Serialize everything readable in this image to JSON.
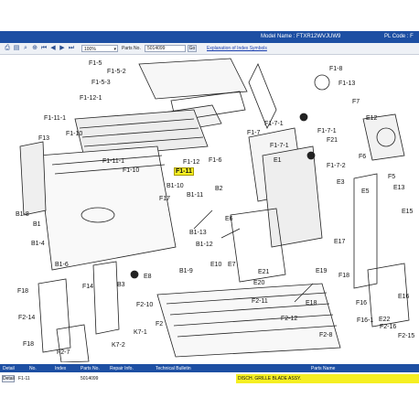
{
  "header": {
    "model": "Model Name : FTXR12WVJUW9",
    "pl_code": "PL Code : F"
  },
  "toolbar": {
    "zoom_value": "100%",
    "parts_no_label": "Parts No.",
    "parts_no_value": "5014099",
    "go_label": "Go",
    "explanation_link": "Explanation of Index Symbols",
    "icons": [
      "print-icon",
      "search-icon",
      "zoom-in-icon",
      "zoom-out-icon",
      "first-page-icon",
      "prev-page-icon",
      "next-page-icon",
      "last-page-icon"
    ]
  },
  "diagram": {
    "labels": [
      "F1-5",
      "F1-5-2",
      "F1-5-3",
      "F1-8",
      "F1-13",
      "F1-12-1",
      "F7",
      "E12",
      "F1-11-1",
      "F1-10",
      "F13",
      "F1-7",
      "F1-7-1",
      "F1-7-1",
      "F1-7-1",
      "F1-7-2",
      "F21",
      "F6",
      "F1-11-1",
      "F1-10",
      "F1-11",
      "F1-12",
      "F1-6",
      "E1",
      "E3",
      "F5",
      "E13",
      "E15",
      "E5",
      "B1-10",
      "B1-11",
      "B2",
      "E6",
      "F17",
      "B1-8",
      "B1",
      "B1-4",
      "B1-13",
      "B1-12",
      "E10",
      "E7",
      "E17",
      "B1-6",
      "B1-9",
      "E21",
      "E19",
      "F18",
      "E20",
      "E18",
      "E16",
      "F14",
      "B3",
      "E8",
      "F2-11",
      "F2-12",
      "F16",
      "F18",
      "F2-14",
      "F2-10",
      "F2",
      "E22",
      "F16-1",
      "F2-16",
      "F18",
      "F2-8",
      "F2-15",
      "F2-7",
      "K7-2",
      "K7-1"
    ],
    "highlighted": "F1-11"
  },
  "table": {
    "headers": [
      "Detail",
      "No.",
      "Index",
      "Parts No.",
      "Repair Info.",
      "Technical Bulletin",
      "Parts Name"
    ],
    "row": {
      "detail_btn": "Detail",
      "index": "F1-11",
      "parts_no": "5014099",
      "parts_name": "DISCH. GRILLE BLADE ASSY."
    }
  },
  "colors": {
    "titlebar": "#1d4fa3",
    "highlight": "#f5ef22"
  }
}
